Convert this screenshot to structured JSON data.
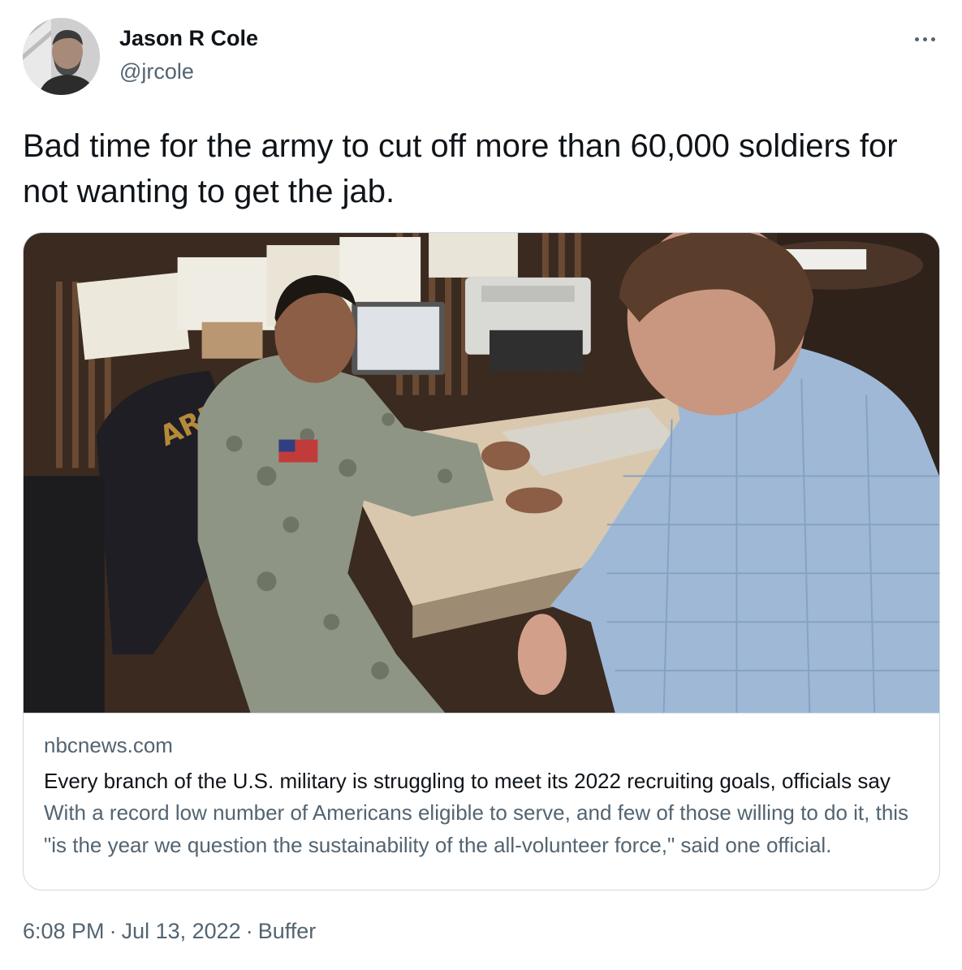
{
  "author": {
    "name": "Jason R Cole",
    "handle": "@jrcole"
  },
  "tweet": {
    "text": "Bad time for the army to cut off more than 60,000 soldiers for not wanting to get the jab."
  },
  "card": {
    "image_icon": "photo-soldier-recruiting-office",
    "domain": "nbcnews.com",
    "title": "Every branch of the U.S. military is struggling to meet its 2022 recruiting goals, officials say",
    "description": "With a record low number of Americans eligible to serve, and few of those willing to do it, this \"is the year we question the sustainability of the all-volunteer force,\" said one official."
  },
  "meta": {
    "time": "6:08 PM",
    "date": "Jul 13, 2022",
    "source": "Buffer",
    "separator": "·"
  },
  "colors": {
    "text_primary": "#0f1419",
    "text_secondary": "#536471",
    "border": "#cfd9de"
  }
}
